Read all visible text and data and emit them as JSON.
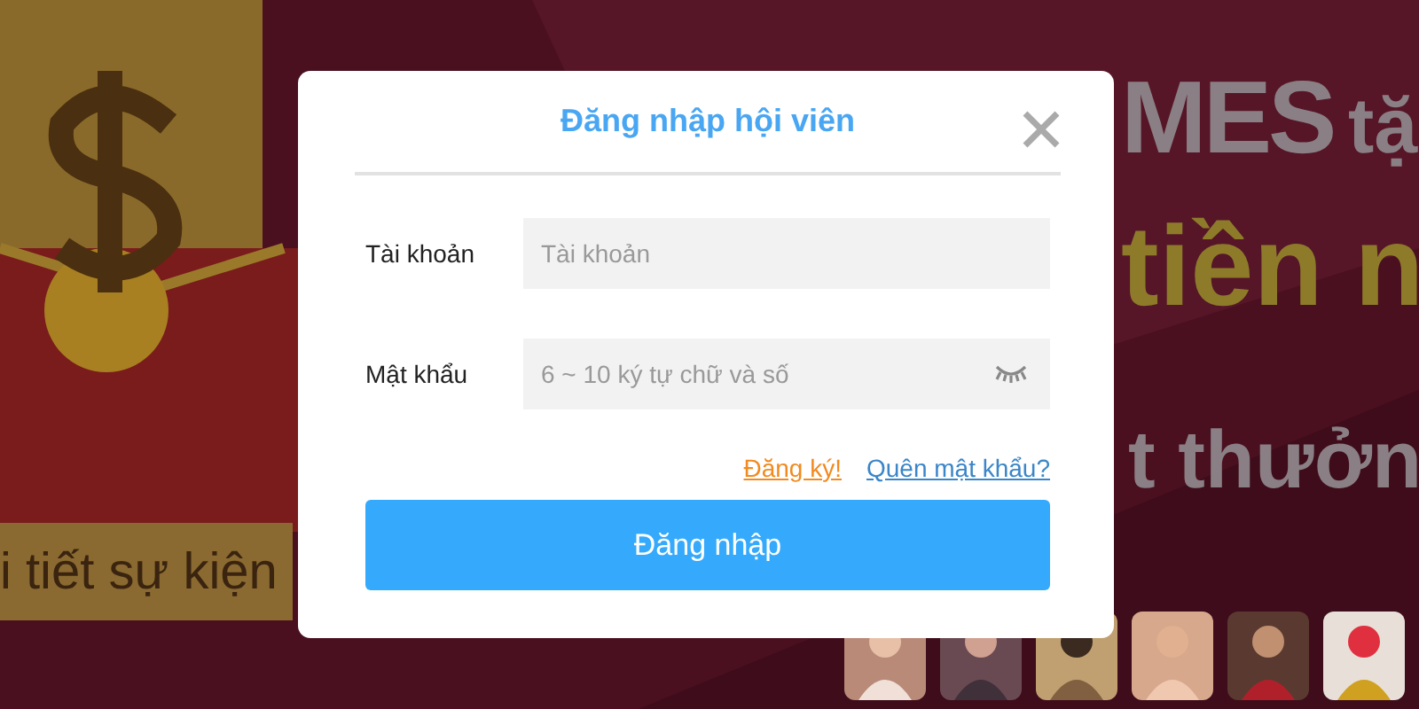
{
  "background": {
    "kind": "picture",
    "texts": [
      "MES",
      "tặ",
      "tiền n",
      "t thưởn",
      "i tiết sự kiện"
    ]
  },
  "dialog": {
    "title": "Đăng nhập hội viên",
    "fields": [
      {
        "label": "Tài khoản",
        "placeholder": "Tài khoản",
        "kind": "text"
      },
      {
        "label": "Mật khẩu",
        "placeholder": "6 ~ 10 ký tự chữ và số",
        "kind": "password"
      }
    ],
    "links": [
      {
        "text": "Đăng ký!",
        "kind": "register"
      },
      {
        "text": "Quên mật khẩu?",
        "kind": "forgot"
      }
    ],
    "submit": "Đăng nhập"
  }
}
